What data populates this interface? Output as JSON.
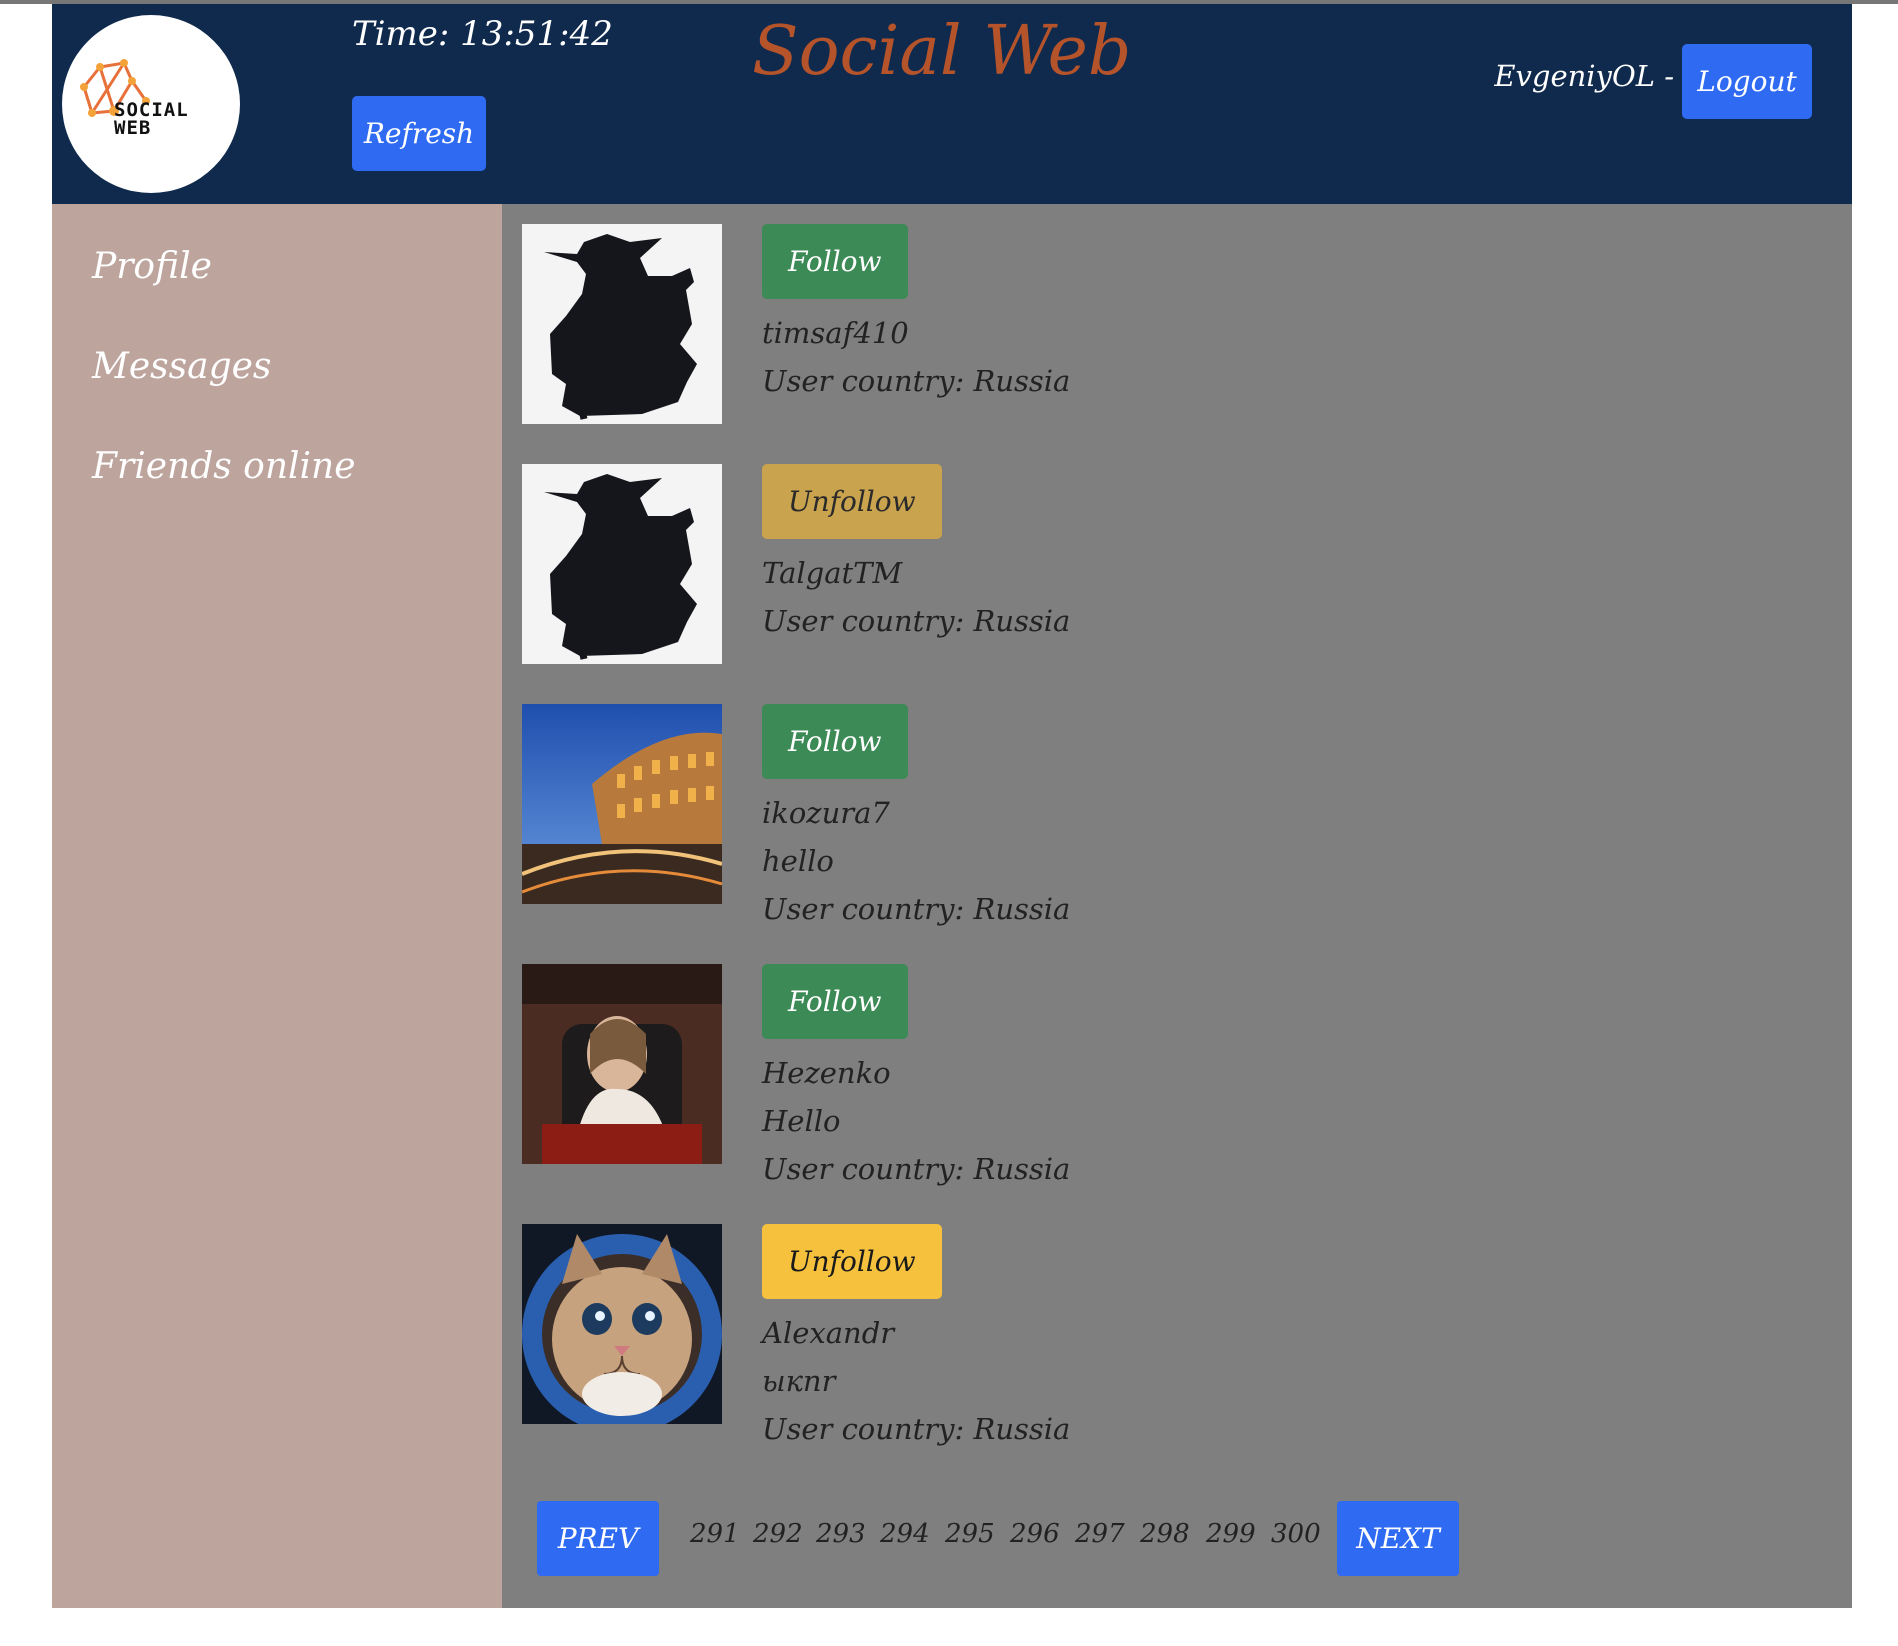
{
  "header": {
    "time_text": "Time: 13:51:42",
    "refresh_label": "Refresh",
    "site_title": "Social Web",
    "username": "EvgeniyOL -",
    "logout_label": "Logout",
    "logo_text": "SOCIAL\nWEB"
  },
  "sidebar": {
    "items": [
      {
        "label": "Profile"
      },
      {
        "label": "Messages"
      },
      {
        "label": "Friends online"
      }
    ]
  },
  "users": [
    {
      "button": "Follow",
      "name": "timsaf410",
      "status": "",
      "country": "User country: Russia",
      "avatar": "yoda-silhouette"
    },
    {
      "button": "Unfollow",
      "name": "TalgatTM",
      "status": "",
      "country": "User country: Russia",
      "avatar": "yoda-silhouette"
    },
    {
      "button": "Follow",
      "name": "ikozura7",
      "status": "hello",
      "country": "User country: Russia",
      "avatar": "colosseum-photo"
    },
    {
      "button": "Follow",
      "name": "Hezenko",
      "status": "Hello",
      "country": "User country: Russia",
      "avatar": "person-photo"
    },
    {
      "button": "Unfollow",
      "name": "Alexandr",
      "status": "ыкпr",
      "country": "User country: Russia",
      "avatar": "astronaut-cat-photo"
    }
  ],
  "pagination": {
    "prev_label": "PREV",
    "next_label": "NEXT",
    "pages": [
      "291",
      "292",
      "293",
      "294",
      "295",
      "296",
      "297",
      "298",
      "299",
      "300"
    ]
  },
  "colors": {
    "header_bg": "#0f2a4d",
    "sidebar_bg": "#bda59e",
    "main_bg": "#7f7f7f",
    "primary": "#2f6bf2",
    "follow": "#3c8a55",
    "unfollow": "#f6c23e",
    "title": "#b5532b"
  }
}
